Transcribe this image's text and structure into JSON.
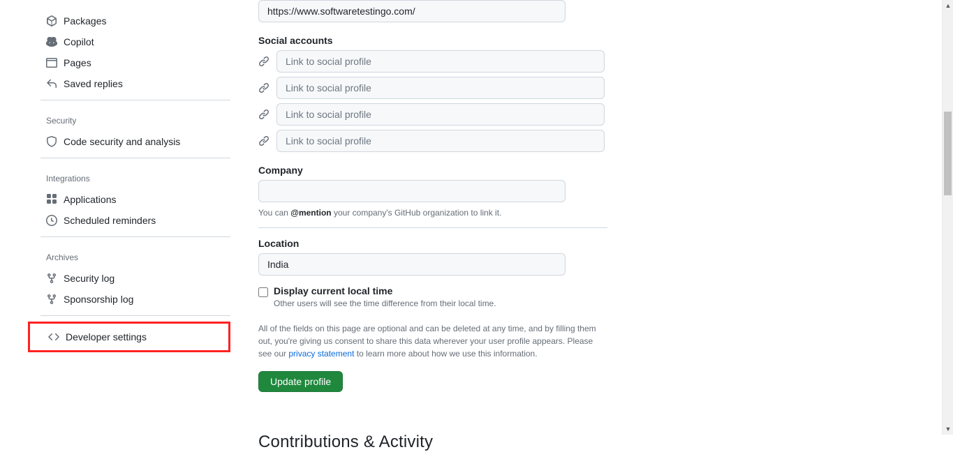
{
  "sidebar": {
    "items": [
      {
        "label": "Packages"
      },
      {
        "label": "Copilot"
      },
      {
        "label": "Pages"
      },
      {
        "label": "Saved replies"
      }
    ],
    "security_header": "Security",
    "security_items": [
      {
        "label": "Code security and analysis"
      }
    ],
    "integrations_header": "Integrations",
    "integrations_items": [
      {
        "label": "Applications"
      },
      {
        "label": "Scheduled reminders"
      }
    ],
    "archives_header": "Archives",
    "archives_items": [
      {
        "label": "Security log"
      },
      {
        "label": "Sponsorship log"
      }
    ],
    "developer_label": "Developer settings"
  },
  "profile": {
    "url_value": "https://www.softwaretestingo.com/",
    "social_label": "Social accounts",
    "social_placeholder": "Link to social profile",
    "company_label": "Company",
    "company_value": "",
    "company_hint_pre": "You can ",
    "company_hint_mention": "@mention",
    "company_hint_post": " your company's GitHub organization to link it.",
    "location_label": "Location",
    "location_value": "India",
    "display_time_label": "Display current local time",
    "display_time_hint": "Other users will see the time difference from their local time.",
    "optional_text_pre": "All of the fields on this page are optional and can be deleted at any time, and by filling them out, you're giving us consent to share this data wherever your user profile appears. Please see our ",
    "privacy_link": "privacy statement",
    "optional_text_post": " to learn more about how we use this information.",
    "update_button": "Update profile",
    "next_heading": "Contributions & Activity"
  }
}
